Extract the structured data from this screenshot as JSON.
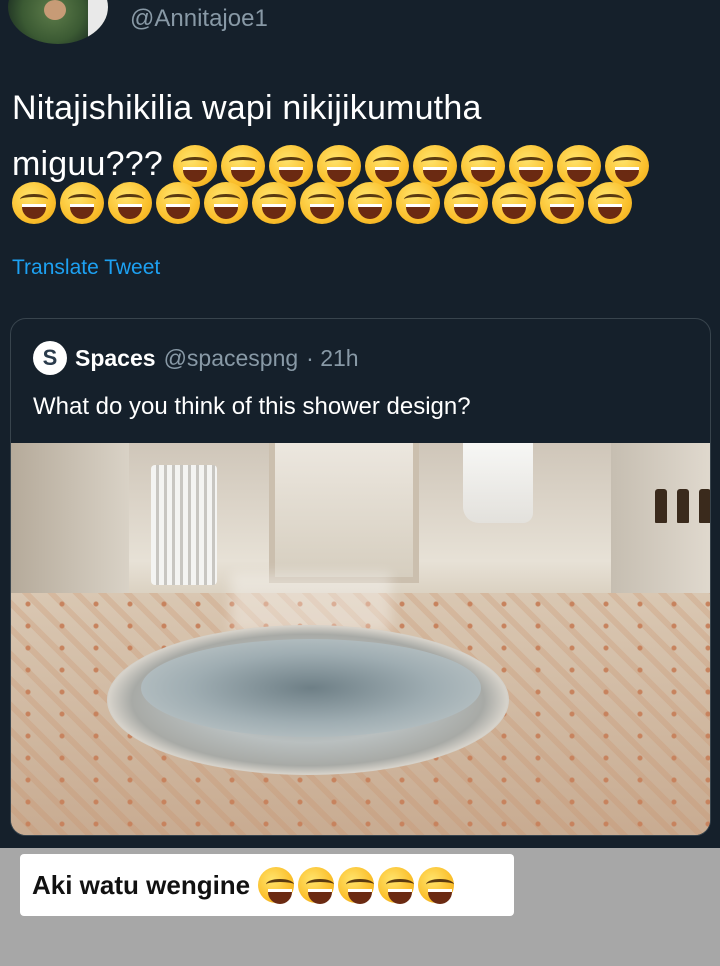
{
  "tweet": {
    "handle": "@Annitajoe1",
    "text_line1": "Nitajishikilia wapi nikijikumutha",
    "text_line2": "miguu???",
    "emoji_line2_count": 10,
    "emoji_line3_count": 13,
    "emoji_name": "rolling-on-floor-laughing",
    "translate": "Translate Tweet"
  },
  "quoted": {
    "name": "Spaces",
    "handle": "@spacespng",
    "time": "· 21h",
    "text": "What do you think of this shower design?",
    "image_desc_icon": "bathroom-photo"
  },
  "story": {
    "caption": "Aki watu wengine",
    "caption_emoji_count": 5
  },
  "colors": {
    "background": "#15202b",
    "link": "#1da1f2",
    "muted": "#8899a6",
    "border": "#38444d",
    "story_bg": "#a7a7a7"
  }
}
